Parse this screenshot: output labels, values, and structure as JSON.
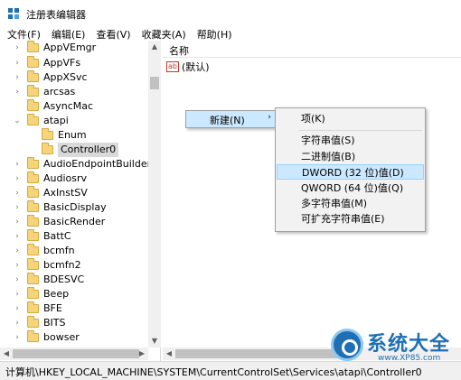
{
  "window": {
    "title": "注册表编辑器"
  },
  "menu": [
    "文件(F)",
    "编辑(E)",
    "查看(V)",
    "收藏夹(A)",
    "帮助(H)"
  ],
  "tree": {
    "items": [
      {
        "label": "AppVEmgr",
        "arrow": "›",
        "level": 1
      },
      {
        "label": "AppVFs",
        "arrow": "›",
        "level": 1
      },
      {
        "label": "AppXSvc",
        "arrow": "›",
        "level": 1
      },
      {
        "label": "arcsas",
        "arrow": "›",
        "level": 1
      },
      {
        "label": "AsyncMac",
        "arrow": "",
        "level": 1
      },
      {
        "label": "atapi",
        "arrow": "⌄",
        "level": 1
      },
      {
        "label": "Enum",
        "arrow": "",
        "level": 2
      },
      {
        "label": "Controller0",
        "arrow": "",
        "level": 2,
        "selected": true
      },
      {
        "label": "AudioEndpointBuilder",
        "arrow": "›",
        "level": 1
      },
      {
        "label": "Audiosrv",
        "arrow": "›",
        "level": 1
      },
      {
        "label": "AxInstSV",
        "arrow": "›",
        "level": 1
      },
      {
        "label": "BasicDisplay",
        "arrow": "›",
        "level": 1
      },
      {
        "label": "BasicRender",
        "arrow": "›",
        "level": 1
      },
      {
        "label": "BattC",
        "arrow": "›",
        "level": 1
      },
      {
        "label": "bcmfn",
        "arrow": "›",
        "level": 1
      },
      {
        "label": "bcmfn2",
        "arrow": "›",
        "level": 1
      },
      {
        "label": "BDESVC",
        "arrow": "›",
        "level": 1
      },
      {
        "label": "Beep",
        "arrow": "›",
        "level": 1
      },
      {
        "label": "BFE",
        "arrow": "›",
        "level": 1
      },
      {
        "label": "BITS",
        "arrow": "›",
        "level": 1
      },
      {
        "label": "bowser",
        "arrow": "›",
        "level": 1
      }
    ]
  },
  "list": {
    "column_name": "名称",
    "default_icon": "ab",
    "default_value": "(默认)"
  },
  "context_menu": {
    "new_label": "新建(N)",
    "new_arrow": "›",
    "submenu": [
      {
        "label": "项(K)"
      },
      {
        "label": "字符串值(S)"
      },
      {
        "label": "二进制值(B)"
      },
      {
        "label": "DWORD (32 位)值(D)",
        "highlighted": true
      },
      {
        "label": "QWORD (64 位)值(Q)"
      },
      {
        "label": "多字符串值(M)"
      },
      {
        "label": "可扩充字符串值(E)"
      }
    ]
  },
  "status": {
    "path": "计算机\\HKEY_LOCAL_MACHINE\\SYSTEM\\CurrentControlSet\\Services\\atapi\\Controller0"
  },
  "watermark": {
    "title": "系统大全",
    "url": "www.XP85.com"
  }
}
